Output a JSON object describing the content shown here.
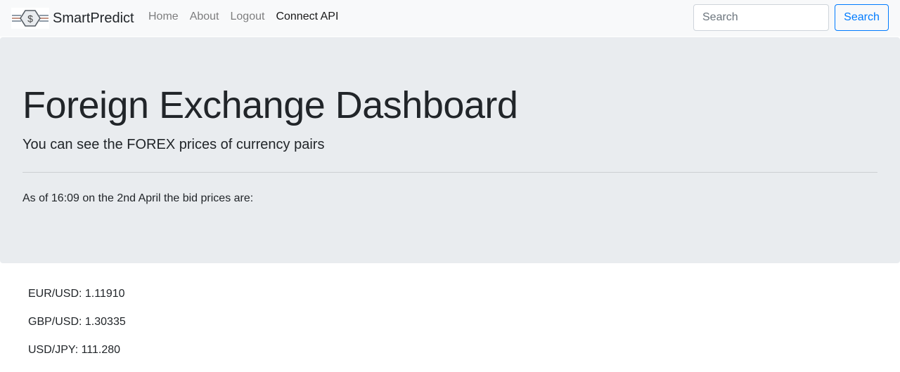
{
  "navbar": {
    "brand_name": "SmartPredict",
    "logo_icon": "dollar-coin-logo",
    "links": [
      {
        "label": "Home",
        "active": false
      },
      {
        "label": "About",
        "active": false
      },
      {
        "label": "Logout",
        "active": false
      },
      {
        "label": "Connect API",
        "active": true
      }
    ],
    "search": {
      "placeholder": "Search",
      "value": ""
    },
    "search_button_label": "Search"
  },
  "jumbotron": {
    "title": "Foreign Exchange Dashboard",
    "lead": "You can see the FOREX prices of currency pairs",
    "as_of": "As of 16:09 on the 2nd April the bid prices are:"
  },
  "prices": [
    {
      "text": "EUR/USD: 1.11910"
    },
    {
      "text": "GBP/USD: 1.30335"
    },
    {
      "text": "USD/JPY: 111.280"
    }
  ],
  "colors": {
    "navbar_bg": "#f8f9fa",
    "jumbotron_bg": "#e9ecef",
    "primary": "#007bff"
  }
}
